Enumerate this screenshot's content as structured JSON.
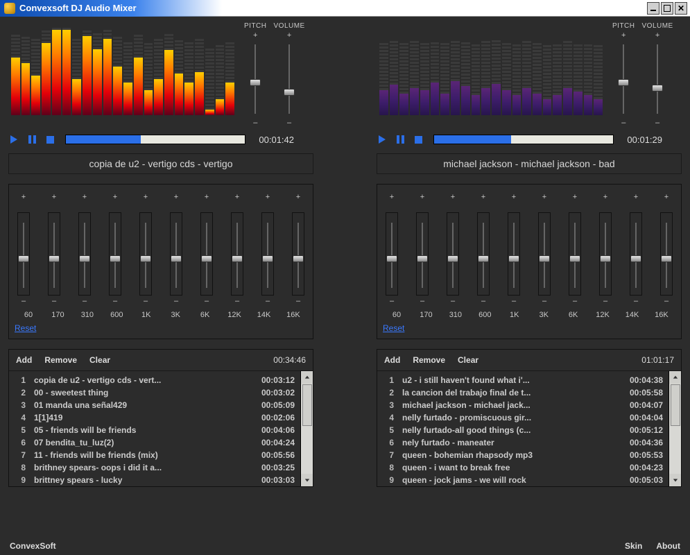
{
  "window": {
    "title": "Convexsoft DJ Audio Mixer"
  },
  "labels": {
    "pitch": "PITCH",
    "volume": "VOLUME",
    "plus": "+",
    "minus": "–",
    "reset": "Reset"
  },
  "eq": {
    "bands": [
      "60",
      "170",
      "310",
      "600",
      "1K",
      "3K",
      "6K",
      "12K",
      "14K",
      "16K"
    ]
  },
  "playlist": {
    "add": "Add",
    "remove": "Remove",
    "clear": "Clear"
  },
  "footer": {
    "brand": "ConvexSoft",
    "skin": "Skin",
    "about": "About"
  },
  "deck1": {
    "progressPct": 42,
    "elapsed": "00:01:42",
    "track": "copia de u2 - vertigo cds - vertigo",
    "pitchPos": 50,
    "volumePos": 64,
    "spectrum": [
      64,
      58,
      44,
      80,
      95,
      95,
      40,
      88,
      73,
      85,
      54,
      36,
      64,
      28,
      40,
      72,
      46,
      36,
      48,
      6,
      18,
      36
    ],
    "playlistTotal": "00:34:46",
    "playlist": [
      {
        "n": 1,
        "name": "copia de u2 - vertigo cds - vert...",
        "dur": "00:03:12"
      },
      {
        "n": 2,
        "name": "00 - sweetest thing",
        "dur": "00:03:02"
      },
      {
        "n": 3,
        "name": "01 manda una señal429",
        "dur": "00:05:09"
      },
      {
        "n": 4,
        "name": "1[1]419",
        "dur": "00:02:06"
      },
      {
        "n": 5,
        "name": "05 - friends will be friends",
        "dur": "00:04:06"
      },
      {
        "n": 6,
        "name": "07 bendita_tu_luz(2)",
        "dur": "00:04:24"
      },
      {
        "n": 7,
        "name": "11 - friends will be friends (mix)",
        "dur": "00:05:56"
      },
      {
        "n": 8,
        "name": "brithney spears- oops i did it a...",
        "dur": "00:03:25"
      },
      {
        "n": 9,
        "name": "brittney spears - lucky",
        "dur": "00:03:03"
      }
    ]
  },
  "deck2": {
    "progressPct": 43,
    "elapsed": "00:01:29",
    "track": "michael jackson - michael jackson - bad",
    "pitchPos": 50,
    "volumePos": 58,
    "spectrum": [
      28,
      34,
      24,
      30,
      28,
      36,
      24,
      38,
      32,
      22,
      30,
      35,
      28,
      22,
      30,
      24,
      18,
      22,
      30,
      26,
      22,
      18
    ],
    "playlistTotal": "01:01:17",
    "playlist": [
      {
        "n": 1,
        "name": "u2 - i still haven't found what i'...",
        "dur": "00:04:38"
      },
      {
        "n": 2,
        "name": "la cancion del trabajo final de t...",
        "dur": "00:05:58"
      },
      {
        "n": 3,
        "name": "michael jackson - michael jack...",
        "dur": "00:04:07"
      },
      {
        "n": 4,
        "name": "nelly furtado - promiscuous gir...",
        "dur": "00:04:04"
      },
      {
        "n": 5,
        "name": "nelly furtado-all good things (c...",
        "dur": "00:05:12"
      },
      {
        "n": 6,
        "name": "nely furtado - maneater",
        "dur": "00:04:36"
      },
      {
        "n": 7,
        "name": "queen - bohemian rhapsody mp3",
        "dur": "00:05:53"
      },
      {
        "n": 8,
        "name": "queen - i want to break free",
        "dur": "00:04:23"
      },
      {
        "n": 9,
        "name": "queen - jock jams - we will rock",
        "dur": "00:05:03"
      }
    ]
  }
}
